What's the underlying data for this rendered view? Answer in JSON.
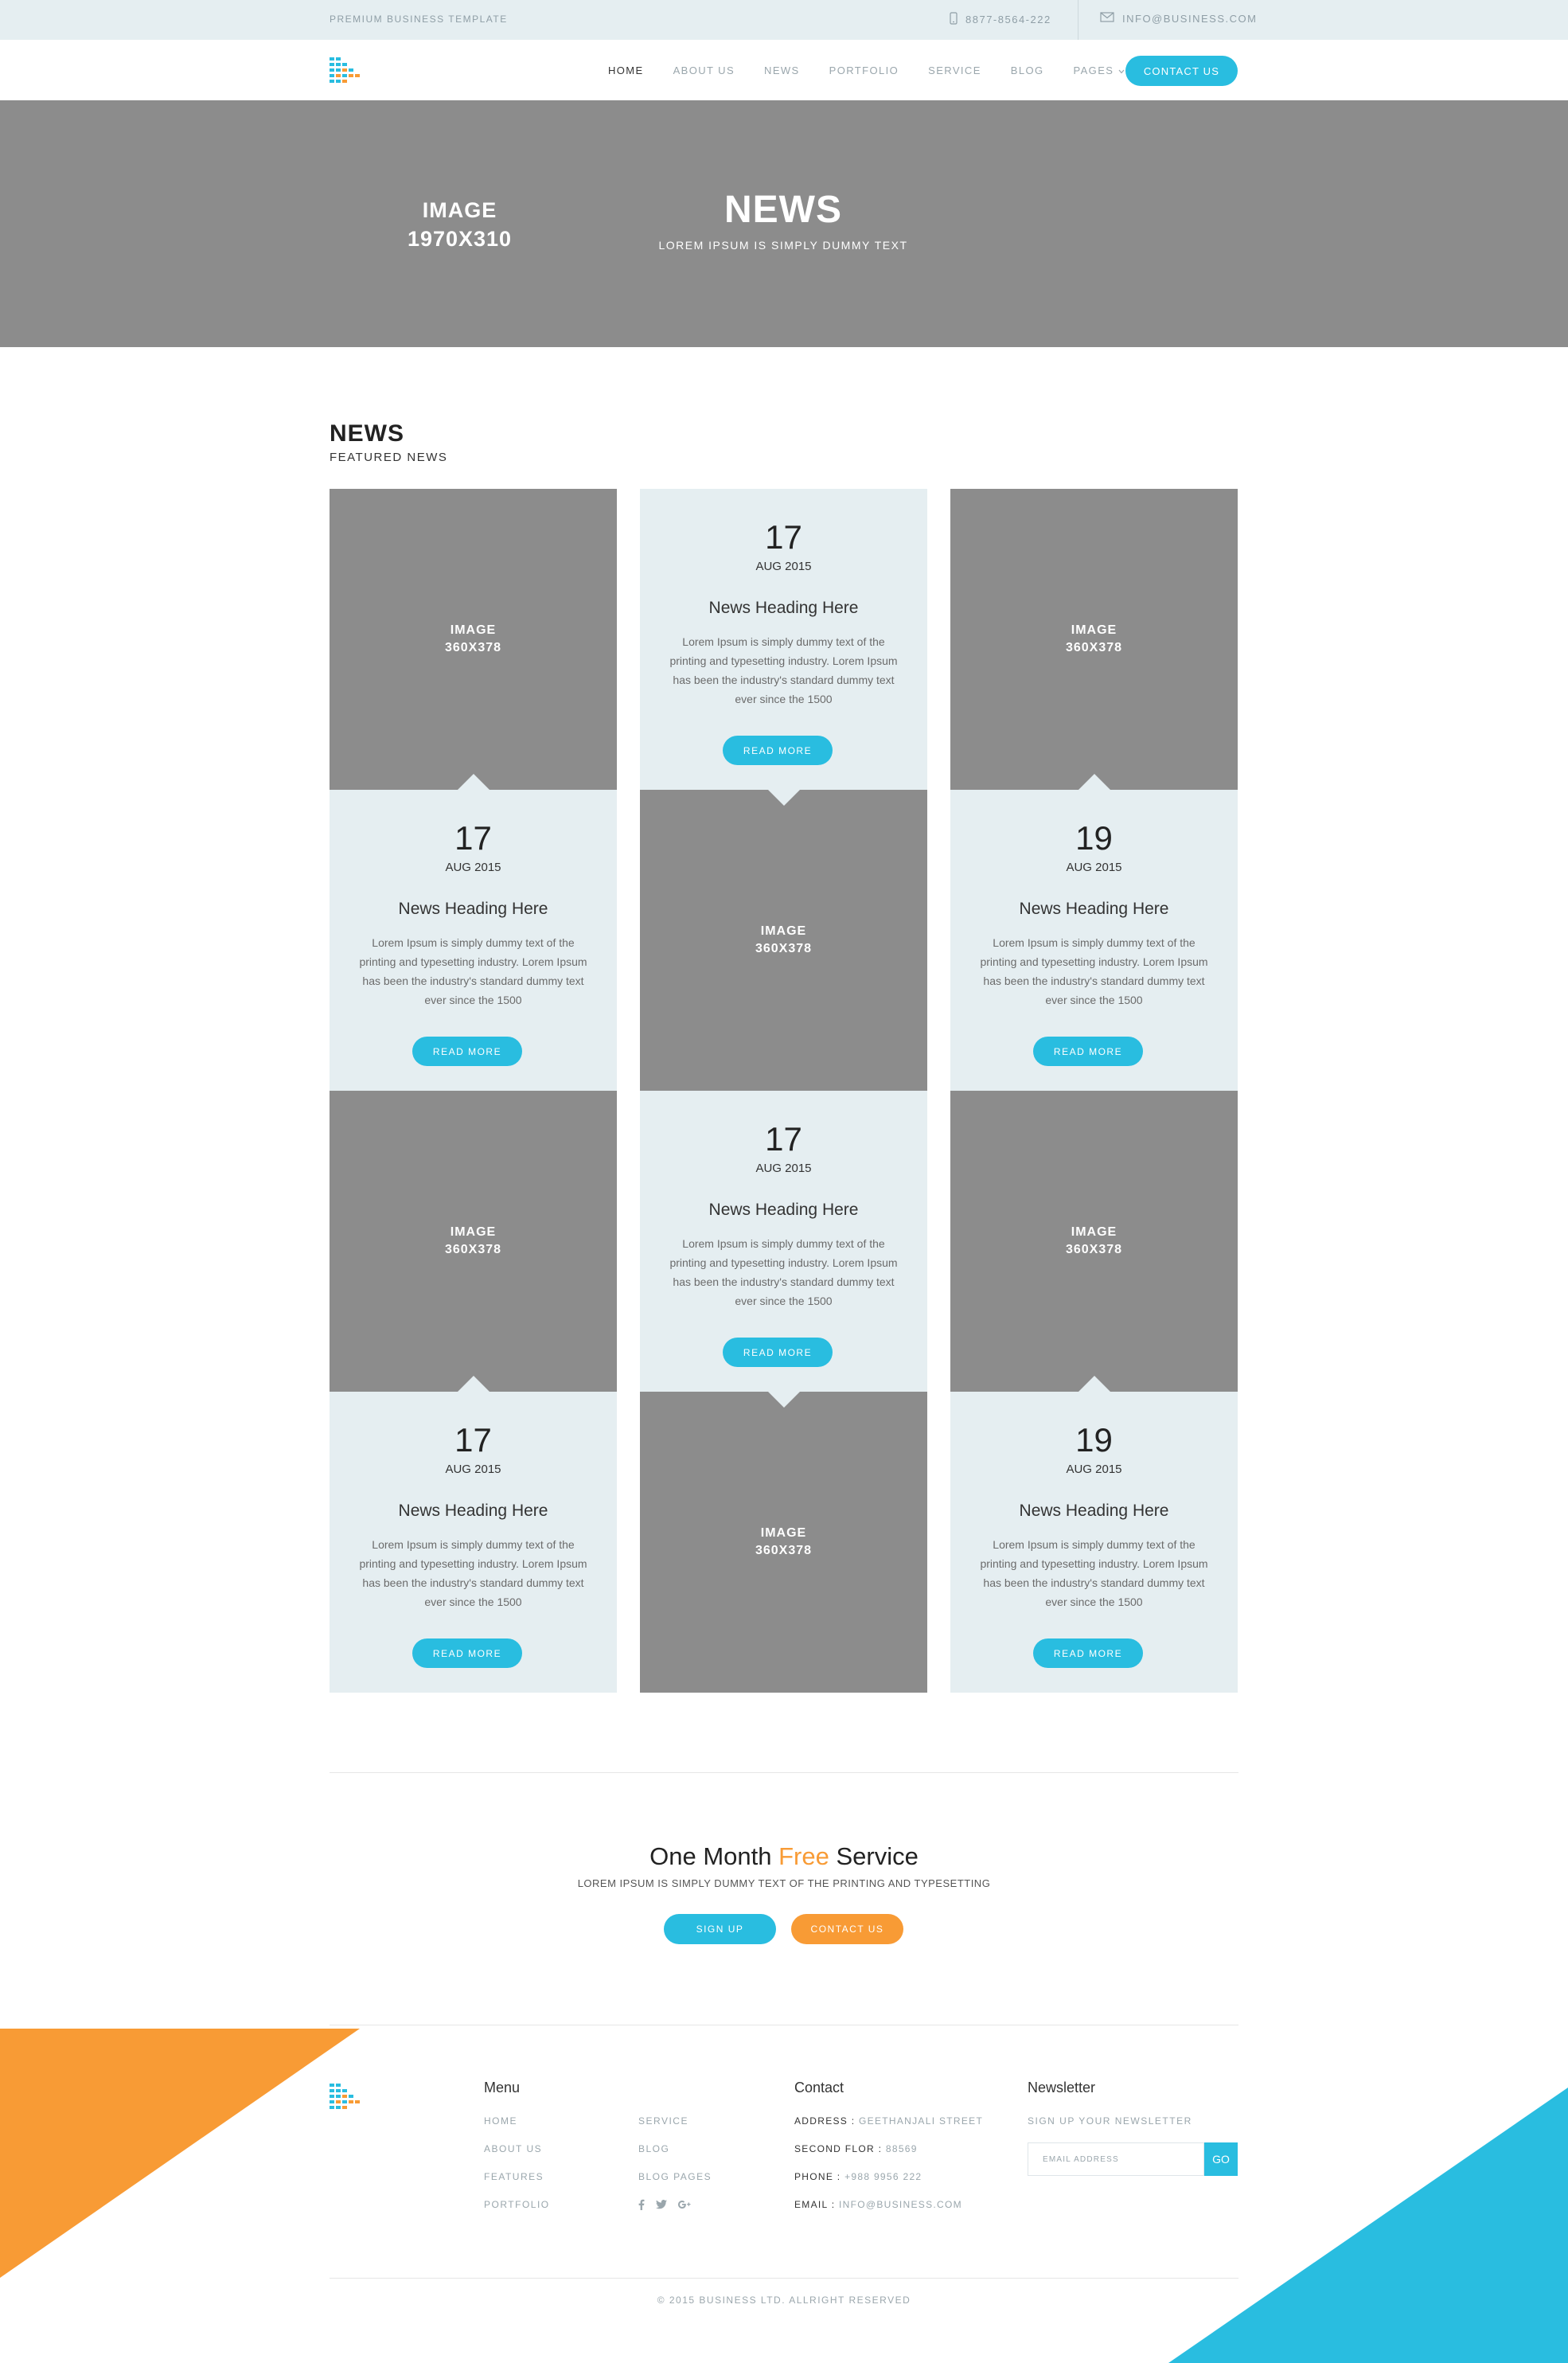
{
  "topbar": {
    "tagline": "PREMIUM BUSINESS TEMPLATE",
    "phone": "8877-8564-222",
    "email": "INFO@BUSINESS.COM"
  },
  "nav": {
    "items": [
      "HOME",
      "ABOUT US",
      "NEWS",
      "PORTFOLIO",
      "SERVICE",
      "BLOG",
      "PAGES"
    ],
    "active": "HOME",
    "contact_label": "CONTACT US"
  },
  "hero": {
    "image_label_1": "IMAGE",
    "image_label_2": "1970X310",
    "title": "NEWS",
    "subtitle": "LOREM IPSUM IS SIMPLY DUMMY TEXT"
  },
  "section": {
    "title": "NEWS",
    "subtitle": "FEATURED NEWS"
  },
  "news": {
    "image_label_1": "IMAGE",
    "image_label_2": "360X378",
    "cards": [
      {
        "day": "17",
        "month": "AUG 2015",
        "heading": "News Heading Here",
        "body": "Lorem Ipsum is simply dummy text of the printing and typesetting industry. Lorem Ipsum has been the industry's standard dummy text ever since the 1500",
        "button": "READ MORE"
      },
      {
        "day": "17",
        "month": "AUG 2015",
        "heading": "News Heading Here",
        "body": "Lorem Ipsum is simply dummy text of the printing and typesetting industry. Lorem Ipsum has been the industry's standard dummy text ever since the 1500",
        "button": "READ MORE"
      },
      {
        "day": "19",
        "month": "AUG 2015",
        "heading": "News Heading Here",
        "body": "Lorem Ipsum is simply dummy text of the printing and typesetting industry. Lorem Ipsum has been the industry's standard dummy text ever since the 1500",
        "button": "READ MORE"
      },
      {
        "day": "17",
        "month": "AUG 2015",
        "heading": "News Heading Here",
        "body": "Lorem Ipsum is simply dummy text of the printing and typesetting industry. Lorem Ipsum has been the industry's standard dummy text ever since the 1500",
        "button": "READ MORE"
      },
      {
        "day": "17",
        "month": "AUG 2015",
        "heading": "News Heading Here",
        "body": "Lorem Ipsum is simply dummy text of the printing and typesetting industry. Lorem Ipsum has been the industry's standard dummy text ever since the 1500",
        "button": "READ MORE"
      },
      {
        "day": "19",
        "month": "AUG 2015",
        "heading": "News Heading Here",
        "body": "Lorem Ipsum is simply dummy text of the printing and typesetting industry. Lorem Ipsum has been the industry's standard dummy text ever since the 1500",
        "button": "READ MORE"
      }
    ]
  },
  "promo": {
    "title_pre": "One Month ",
    "title_highlight": "Free",
    "title_post": " Service",
    "subtitle": "LOREM IPSUM IS SIMPLY DUMMY TEXT OF THE PRINTING AND TYPESETTING",
    "signup_label": "SIGN UP",
    "contact_label": "CONTACT US"
  },
  "footer": {
    "menu_title": "Menu",
    "menu_col1": [
      "HOME",
      "ABOUT US",
      "FEATURES",
      "PORTFOLIO"
    ],
    "menu_col2": [
      "SERVICE",
      "BLOG",
      "BLOG PAGES"
    ],
    "social_icons": [
      "facebook-icon",
      "twitter-icon",
      "google-plus-icon"
    ],
    "contact_title": "Contact",
    "contact": [
      {
        "label": "ADDRESS :",
        "value": " GEETHANJALI STREET"
      },
      {
        "label": "SECOND FLOR :",
        "value": " 88569"
      },
      {
        "label": "PHONE :",
        "value": " +988 9956 222"
      },
      {
        "label": "EMAIL :",
        "value": " INFO@BUSINESS.COM"
      }
    ],
    "newsletter_title": "Newsletter",
    "newsletter_sub": "SIGN UP YOUR NEWSLETTER",
    "newsletter_placeholder": "EMAIL ADDRESS",
    "newsletter_button": "GO",
    "copyright": "© 2015 BUSINESS LTD. ALLRIGHT RESERVED"
  },
  "colors": {
    "accent_blue": "#29bde0",
    "accent_orange": "#f89b35",
    "placeholder_gray": "#8c8c8c",
    "card_bg": "#e5eef1"
  }
}
